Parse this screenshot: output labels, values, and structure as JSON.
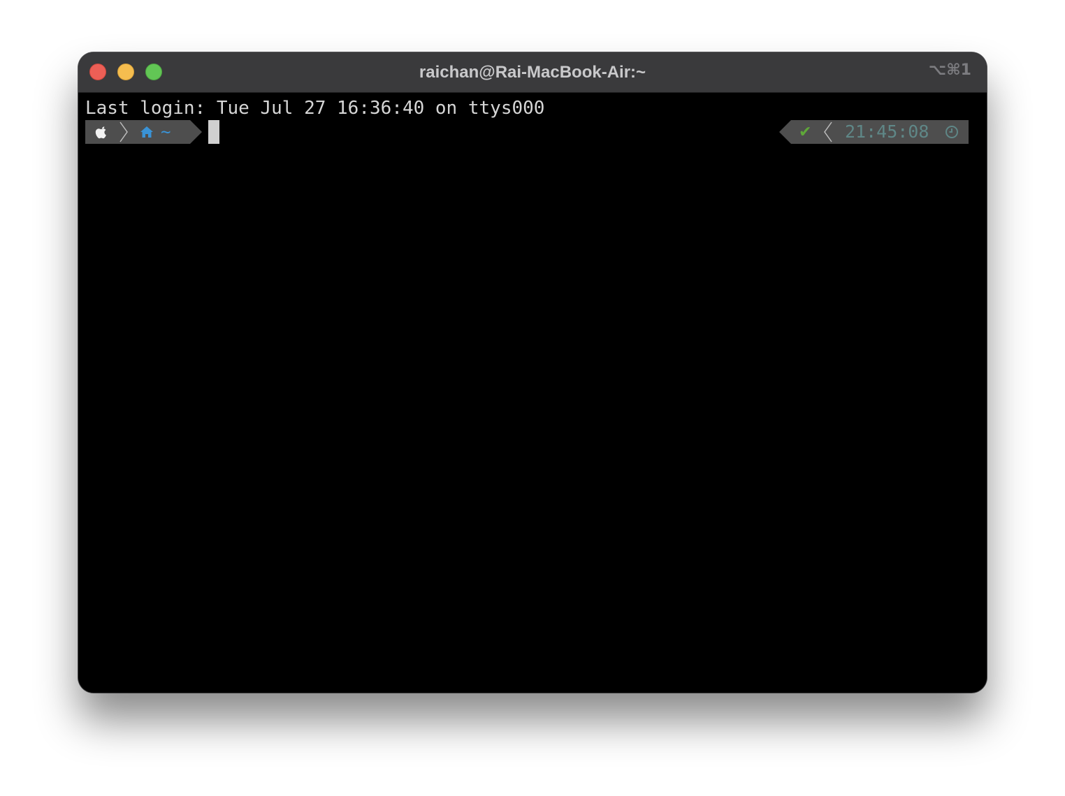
{
  "window": {
    "title": "raichan@Rai-MacBook-Air:~",
    "shortcut": "⌥⌘1"
  },
  "terminal": {
    "last_login_line": "Last login: Tue Jul 27 16:36:40 on ttys000",
    "prompt_left": {
      "os_icon": "apple-icon",
      "dir_icon": "home-icon",
      "path": "~"
    },
    "prompt_right": {
      "status_icon": "check-icon",
      "status_symbol": "✔",
      "time": "21:45:08",
      "time_icon": "clock-icon"
    }
  },
  "colors": {
    "titlebar": "#3a3a3c",
    "background": "#000000",
    "text": "#d6d6d6",
    "segment": "#4e4e4e",
    "path": "#3a93d6",
    "ok": "#5fa839",
    "time": "#5f8787",
    "close": "#ec5f56",
    "minimize": "#f5bd4f",
    "maximize": "#62c655"
  }
}
